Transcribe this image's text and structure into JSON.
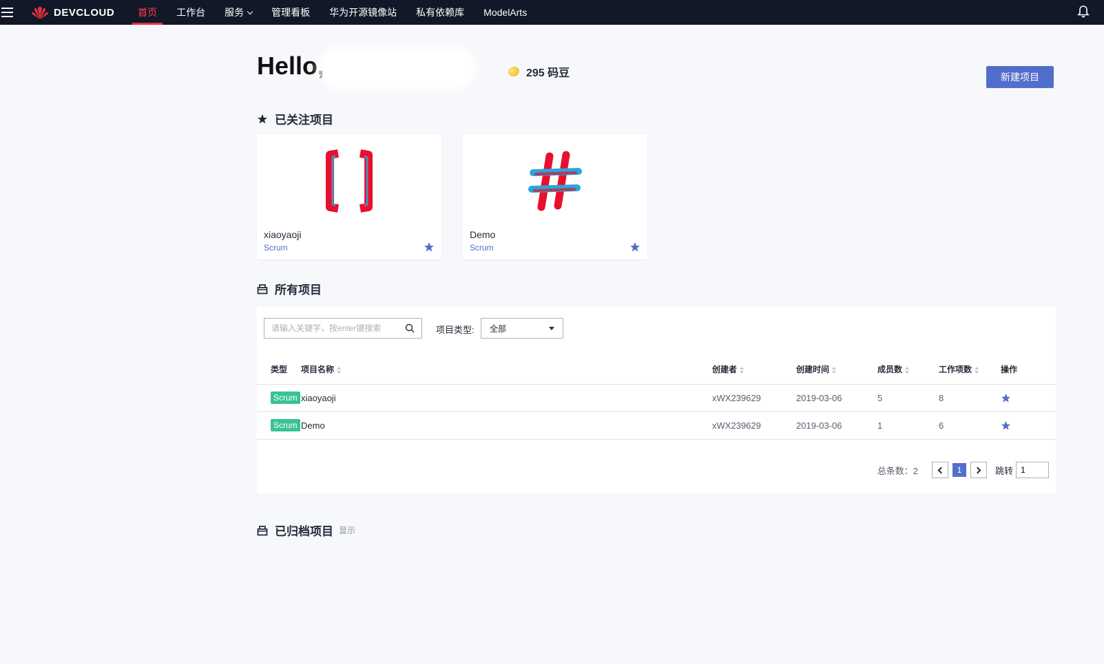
{
  "nav": {
    "logo_text": "DEVCLOUD",
    "items": [
      {
        "label": "首页",
        "active": true
      },
      {
        "label": "工作台"
      },
      {
        "label": "服务"
      },
      {
        "label": "管理看板"
      },
      {
        "label": "华为开源镜像站"
      },
      {
        "label": "私有依赖库"
      },
      {
        "label": "ModelArts"
      }
    ]
  },
  "header": {
    "greeting": "Hello,",
    "beans": "295 码豆",
    "new_project": "新建项目"
  },
  "followed": {
    "title": "已关注项目",
    "cards": [
      {
        "name": "xiaoyaoji",
        "type": "Scrum"
      },
      {
        "name": "Demo",
        "type": "Scrum"
      }
    ]
  },
  "all_projects": {
    "title": "所有项目",
    "search_placeholder": "请输入关键字，按enter键搜索",
    "type_label": "项目类型:",
    "type_value": "全部",
    "columns": [
      "类型",
      "项目名称",
      "创建者",
      "创建时间",
      "成员数",
      "工作项数",
      "操作"
    ],
    "rows": [
      {
        "type": "Scrum",
        "name": "xiaoyaoji",
        "creator": "xWX239629",
        "created": "2019-03-06",
        "members": "5",
        "items": "8"
      },
      {
        "type": "Scrum",
        "name": "Demo",
        "creator": "xWX239629",
        "created": "2019-03-06",
        "members": "1",
        "items": "6"
      }
    ],
    "pager": {
      "total": "总条数：2",
      "current": "1",
      "jump_label": "跳转",
      "jump_value": "1"
    }
  },
  "archived": {
    "title": "已归档项目",
    "show": "显示"
  },
  "colors": {
    "nav_bg": "#121827",
    "accent": "#526ecc",
    "active_red": "#e5323f",
    "badge_green": "#3ac295"
  }
}
